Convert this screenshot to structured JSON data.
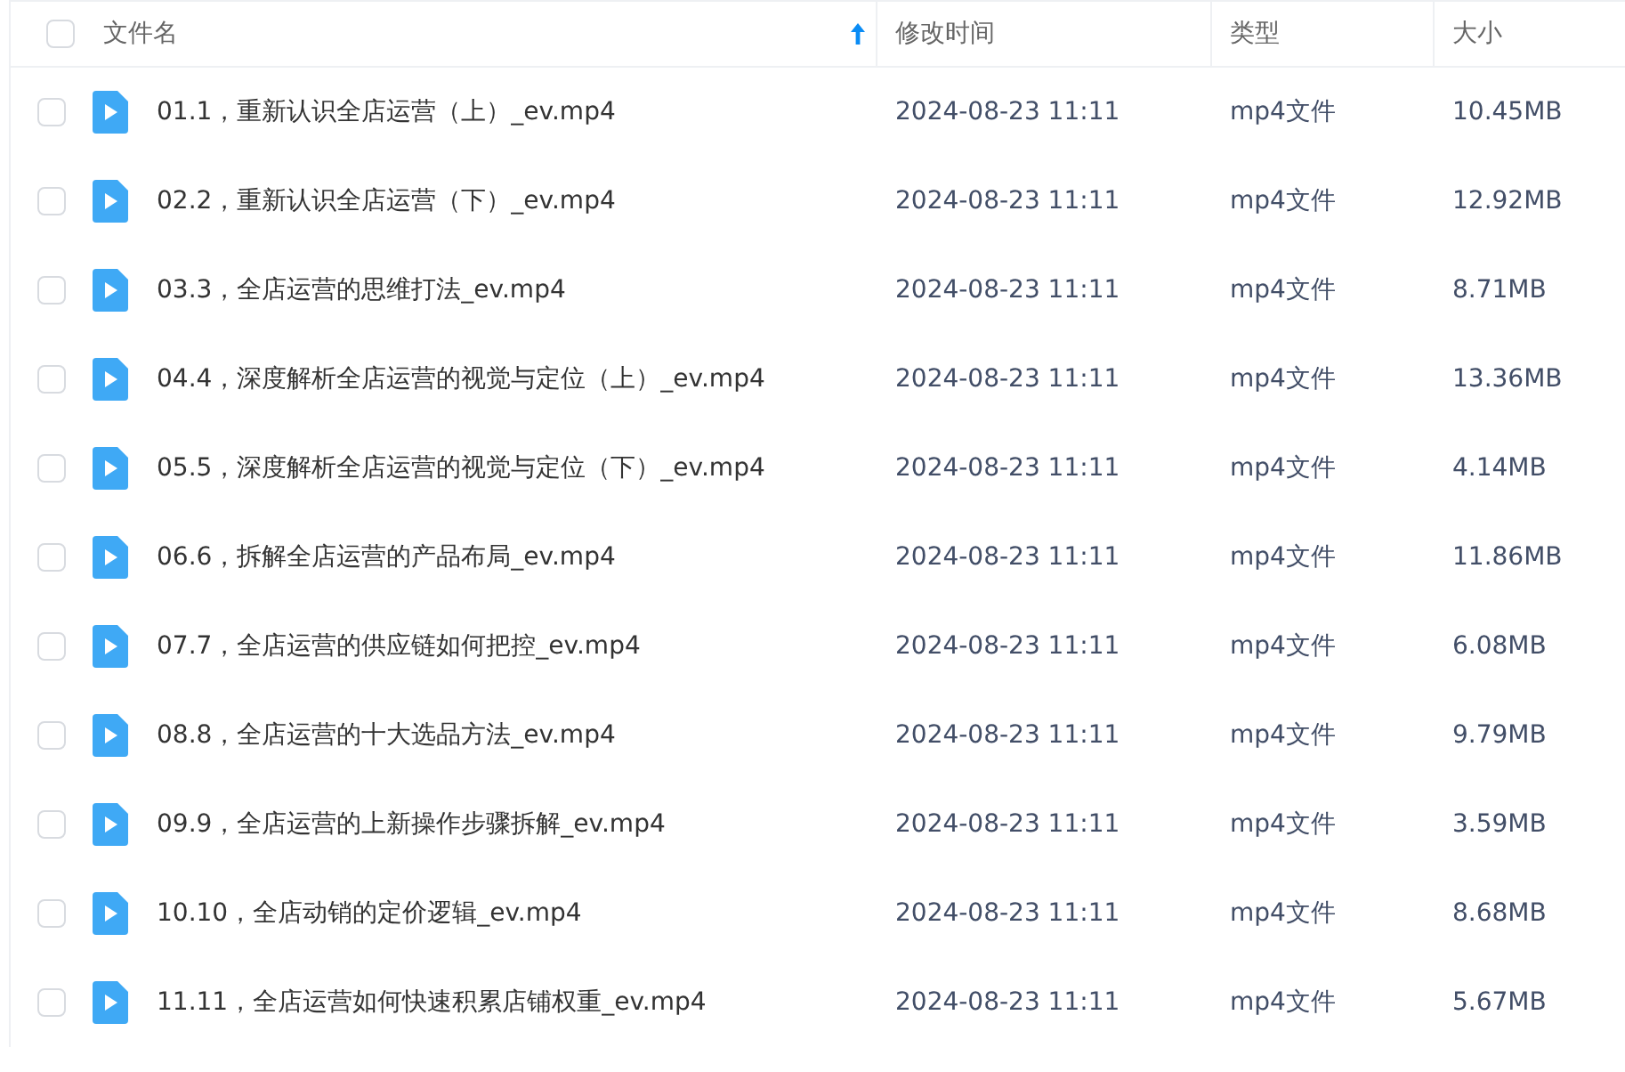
{
  "table": {
    "select_all": {
      "checked": false
    },
    "columns": [
      {
        "label": "文件名",
        "sorted": true
      },
      {
        "label": "修改时间",
        "sorted": false
      },
      {
        "label": "类型",
        "sorted": false
      },
      {
        "label": "大小",
        "sorted": false
      }
    ],
    "rows": [
      {
        "checked": false,
        "name": "01.1，重新认识全店运营（上）_ev.mp4",
        "modified": "2024-08-23 11:11",
        "type": "mp4文件",
        "size": "10.45MB"
      },
      {
        "checked": false,
        "name": "02.2，重新认识全店运营（下）_ev.mp4",
        "modified": "2024-08-23 11:11",
        "type": "mp4文件",
        "size": "12.92MB"
      },
      {
        "checked": false,
        "name": "03.3，全店运营的思维打法_ev.mp4",
        "modified": "2024-08-23 11:11",
        "type": "mp4文件",
        "size": "8.71MB"
      },
      {
        "checked": false,
        "name": "04.4，深度解析全店运营的视觉与定位（上）_ev.mp4",
        "modified": "2024-08-23 11:11",
        "type": "mp4文件",
        "size": "13.36MB"
      },
      {
        "checked": false,
        "name": "05.5，深度解析全店运营的视觉与定位（下）_ev.mp4",
        "modified": "2024-08-23 11:11",
        "type": "mp4文件",
        "size": "4.14MB"
      },
      {
        "checked": false,
        "name": "06.6，拆解全店运营的产品布局_ev.mp4",
        "modified": "2024-08-23 11:11",
        "type": "mp4文件",
        "size": "11.86MB"
      },
      {
        "checked": false,
        "name": "07.7，全店运营的供应链如何把控_ev.mp4",
        "modified": "2024-08-23 11:11",
        "type": "mp4文件",
        "size": "6.08MB"
      },
      {
        "checked": false,
        "name": "08.8，全店运营的十大选品方法_ev.mp4",
        "modified": "2024-08-23 11:11",
        "type": "mp4文件",
        "size": "9.79MB"
      },
      {
        "checked": false,
        "name": "09.9，全店运营的上新操作步骤拆解_ev.mp4",
        "modified": "2024-08-23 11:11",
        "type": "mp4文件",
        "size": "3.59MB"
      },
      {
        "checked": false,
        "name": "10.10，全店动销的定价逻辑_ev.mp4",
        "modified": "2024-08-23 11:11",
        "type": "mp4文件",
        "size": "8.68MB"
      },
      {
        "checked": false,
        "name": "11.11，全店运营如何快速积累店铺权重_ev.mp4",
        "modified": "2024-08-23 11:11",
        "type": "mp4文件",
        "size": "5.67MB"
      }
    ]
  }
}
